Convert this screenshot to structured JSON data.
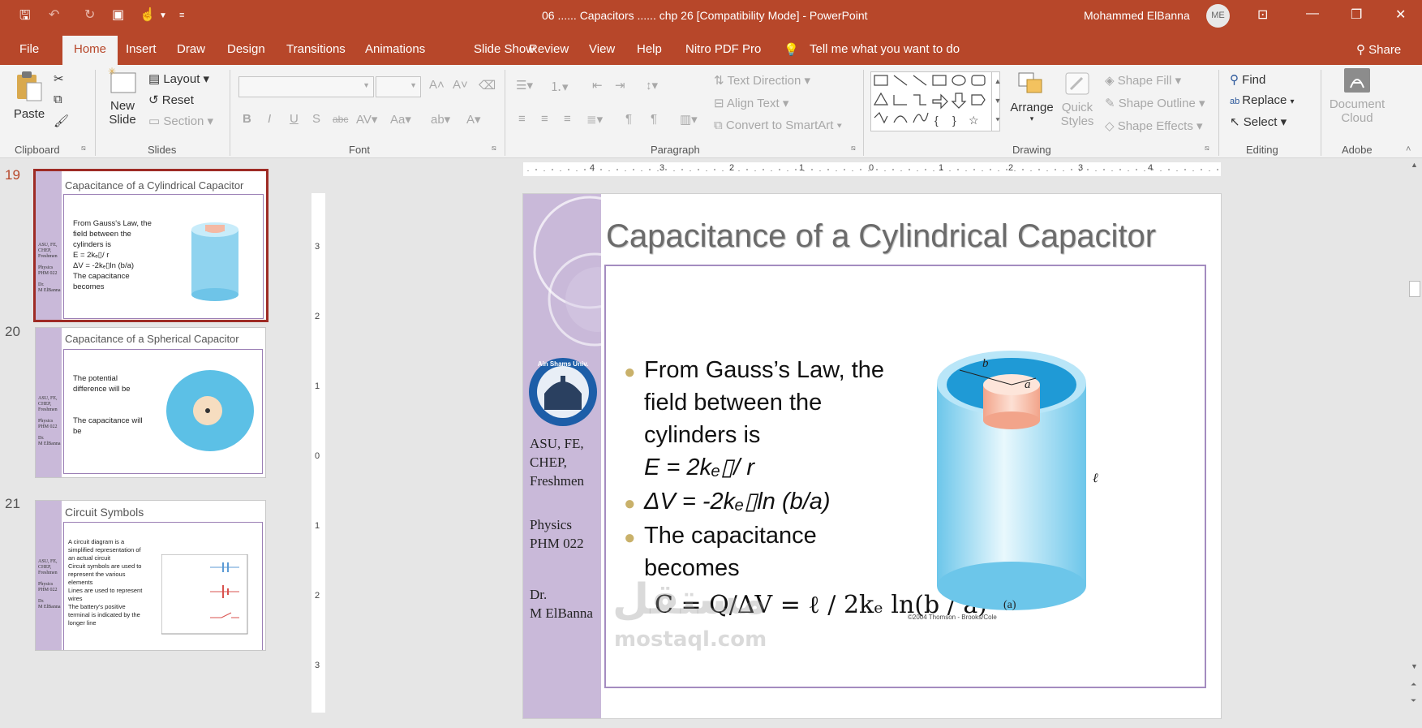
{
  "window": {
    "title": "06 ...... Capacitors ...... chp 26 [Compatibility Mode]  -  PowerPoint",
    "user": "Mohammed ElBanna",
    "user_initials": "ME"
  },
  "tabs": [
    {
      "label": "File"
    },
    {
      "label": "Home"
    },
    {
      "label": "Insert"
    },
    {
      "label": "Draw"
    },
    {
      "label": "Design"
    },
    {
      "label": "Transitions"
    },
    {
      "label": "Animations"
    },
    {
      "label": "Slide Show"
    },
    {
      "label": "Review"
    },
    {
      "label": "View"
    },
    {
      "label": "Help"
    },
    {
      "label": "Nitro PDF Pro"
    }
  ],
  "tell_me": "Tell me what you want to do",
  "share": "Share",
  "ribbon": {
    "clipboard": {
      "label": "Clipboard",
      "paste": "Paste"
    },
    "slides": {
      "label": "Slides",
      "new_slide": "New",
      "new_slide2": "Slide",
      "layout": "Layout",
      "reset": "Reset",
      "section": "Section"
    },
    "font": {
      "label": "Font"
    },
    "paragraph": {
      "label": "Paragraph",
      "text_direction": "Text Direction",
      "align_text": "Align Text",
      "convert_smartart": "Convert to SmartArt"
    },
    "drawing": {
      "label": "Drawing",
      "arrange": "Arrange",
      "quick_styles": "Quick",
      "quick_styles2": "Styles",
      "shape_fill": "Shape Fill",
      "shape_outline": "Shape Outline",
      "shape_effects": "Shape Effects"
    },
    "editing": {
      "label": "Editing",
      "find": "Find",
      "replace": "Replace",
      "select": "Select"
    },
    "adobe": {
      "label": "Adobe",
      "doc_cloud": "Document",
      "doc_cloud2": "Cloud"
    }
  },
  "thumbnails": [
    {
      "num": "19",
      "title": "Capacitance of a Cylindrical Capacitor",
      "lines": [
        "From Gauss's Law, the",
        "field between the",
        "cylinders is",
        "E = 2kₑ▯/ r",
        "ΔV = -2kₑ▯ln (b/a)",
        "The capacitance",
        "becomes"
      ]
    },
    {
      "num": "20",
      "title": "Capacitance of a Spherical Capacitor",
      "lines": [
        "The potential",
        "difference will be",
        "The capacitance will",
        "be"
      ]
    },
    {
      "num": "21",
      "title": "Circuit Symbols",
      "lines": [
        "A circuit diagram is a",
        "simplified representation of",
        "an actual circuit",
        "Circuit symbols are used to",
        "represent the various",
        "elements",
        "Lines are used to represent",
        "wires",
        "The battery's positive",
        "terminal is indicated by the",
        "longer line"
      ]
    }
  ],
  "slide": {
    "title": "Capacitance of a Cylindrical Capacitor",
    "side": {
      "l1": "ASU, FE,",
      "l2": "CHEP,",
      "l3": "Freshmen",
      "l4": "Physics",
      "l5": "PHM 022",
      "l6": "Dr.",
      "l7": "M ElBanna"
    },
    "bullets": {
      "b1a": "From Gauss’s Law, the",
      "b1b": "field between the",
      "b1c": "cylinders is",
      "eq1": "E = 2kₑ▯/ r",
      "b2": "ΔV = -2kₑ▯ln (b/a)",
      "b3a": "The capacitance",
      "b3b": "becomes"
    },
    "formula": "C = Q/ΔV = ℓ / 2kₑ ln(b / a)",
    "figure": {
      "label_a": "a",
      "label_b": "b",
      "label_l": "ℓ",
      "caption": "(a)",
      "credit": "©2004 Thomson - Brooks/Cole"
    },
    "logo_text": "Ain Shams University · Faculty of Engineering"
  },
  "watermark": {
    "line1": "مستقل",
    "line2": "mostaql.com"
  },
  "ruler_h": [
    "4",
    "3",
    "2",
    "1",
    "0",
    "1",
    "2",
    "3",
    "4"
  ],
  "ruler_v": [
    "3",
    "2",
    "1",
    "0",
    "1",
    "2",
    "3"
  ]
}
